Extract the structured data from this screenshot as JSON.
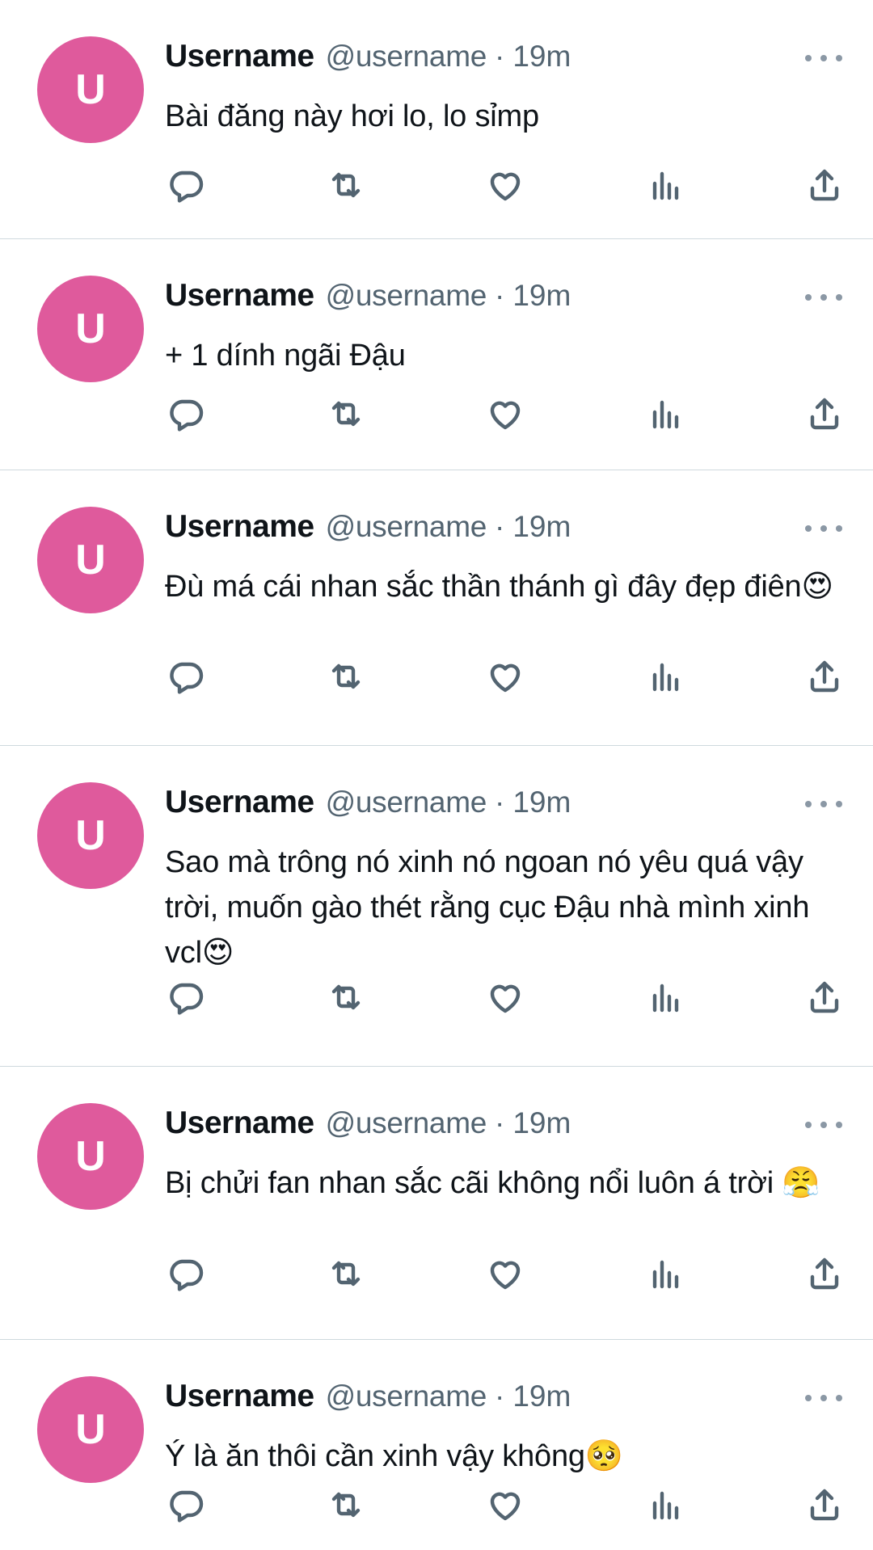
{
  "avatar_letter": "U",
  "tweets": [
    {
      "display_name": "Username",
      "handle": "@username",
      "separator": "·",
      "time": "19m",
      "text": "Bài đăng này hơi lo, lo sỉmp"
    },
    {
      "display_name": "Username",
      "handle": "@username",
      "separator": "·",
      "time": "19m",
      "text": "+ 1 dính ngãi Đậu"
    },
    {
      "display_name": "Username",
      "handle": "@username",
      "separator": "·",
      "time": "19m",
      "text": "Đù má cái nhan sắc thần thánh gì đây đẹp điên😍"
    },
    {
      "display_name": "Username",
      "handle": "@username",
      "separator": "·",
      "time": "19m",
      "text": "Sao mà trông nó xinh nó ngoan nó yêu quá vậy trời, muốn gào thét rằng cục Đậu nhà mình xinh vcl😍"
    },
    {
      "display_name": "Username",
      "handle": "@username",
      "separator": "·",
      "time": "19m",
      "text": "Bị chửi fan nhan sắc cãi không nổi luôn á trời 😤"
    },
    {
      "display_name": "Username",
      "handle": "@username",
      "separator": "·",
      "time": "19m",
      "text": "Ý là ăn thôi cần xinh vậy không🥺"
    }
  ],
  "icons": {
    "reply": "reply-icon",
    "retweet": "retweet-icon",
    "like": "heart-icon",
    "views": "analytics-icon",
    "share": "share-icon",
    "more": "more-icon"
  },
  "colors": {
    "avatar": "#df5a9c",
    "text": "#0f1419",
    "secondary": "#536471",
    "divider": "#cfd9de"
  }
}
